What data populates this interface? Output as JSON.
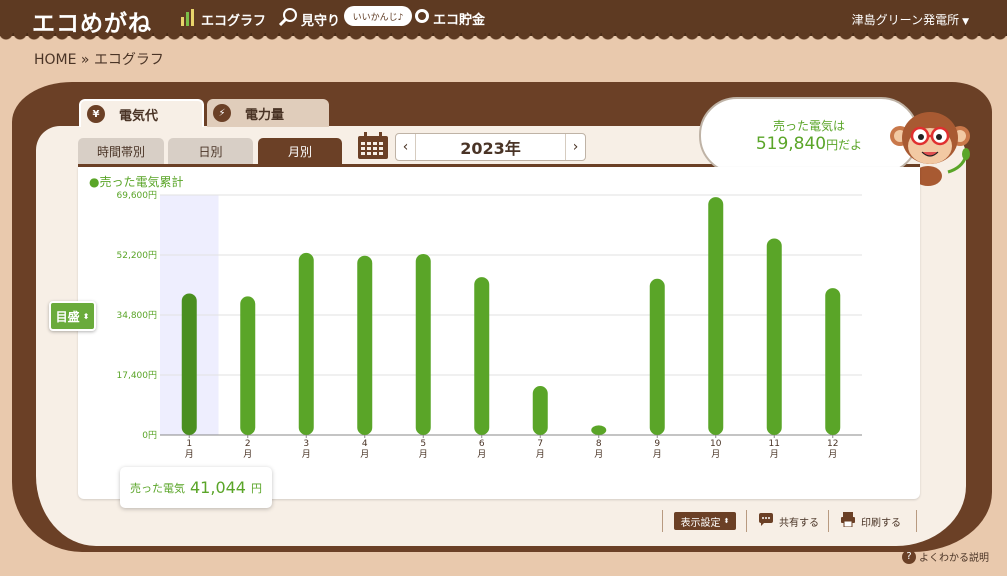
{
  "header": {
    "logo": "エコめがね",
    "nav": [
      {
        "label": "エコグラフ",
        "icon": "bar-chart-icon"
      },
      {
        "label": "見守り",
        "icon": "binoculars-icon"
      },
      {
        "label": "エコ貯金",
        "icon": "coin-icon"
      }
    ],
    "bubble_text": "いいかんじ♪",
    "user": "津島グリーン発電所"
  },
  "breadcrumb": "HOME » エコグラフ",
  "type_tabs": {
    "denki": {
      "label": "電気代",
      "icon_glyph": "¥"
    },
    "denryoku": {
      "label": "電力量",
      "icon_glyph": "⚡"
    }
  },
  "period_tabs": [
    "時間帯別",
    "日別",
    "月別"
  ],
  "year": "2023年",
  "year_nav": {
    "prev": "‹",
    "next": "›"
  },
  "bubble": {
    "label": "売った電気は",
    "value": "519,840",
    "suffix": "円だよ"
  },
  "legend": "●売った電気累計",
  "scale_button": "目盛",
  "tooltip": {
    "label": "売った電気",
    "value": "41,044",
    "unit": "円"
  },
  "actions": {
    "display": "表示設定",
    "share": "共有する",
    "print": "印刷する"
  },
  "help": "よくわかる説明",
  "colors": {
    "bar": "#5aa528",
    "bar_dark": "#4a8f20",
    "highlight": "#eeeefe",
    "brown": "#6b4026"
  },
  "chart_data": {
    "type": "bar",
    "categories": [
      "1",
      "2",
      "3",
      "4",
      "5",
      "6",
      "7",
      "8",
      "9",
      "10",
      "11",
      "12"
    ],
    "category_suffix": "月",
    "values": [
      41044,
      40200,
      52800,
      52000,
      52500,
      45800,
      14200,
      2800,
      45300,
      69000,
      57000,
      42600
    ],
    "y_ticks": [
      "0円",
      "17,400円",
      "34,800円",
      "52,200円",
      "69,600円"
    ],
    "ylim": [
      0,
      69600
    ],
    "highlighted_index": 0,
    "grid": true
  }
}
